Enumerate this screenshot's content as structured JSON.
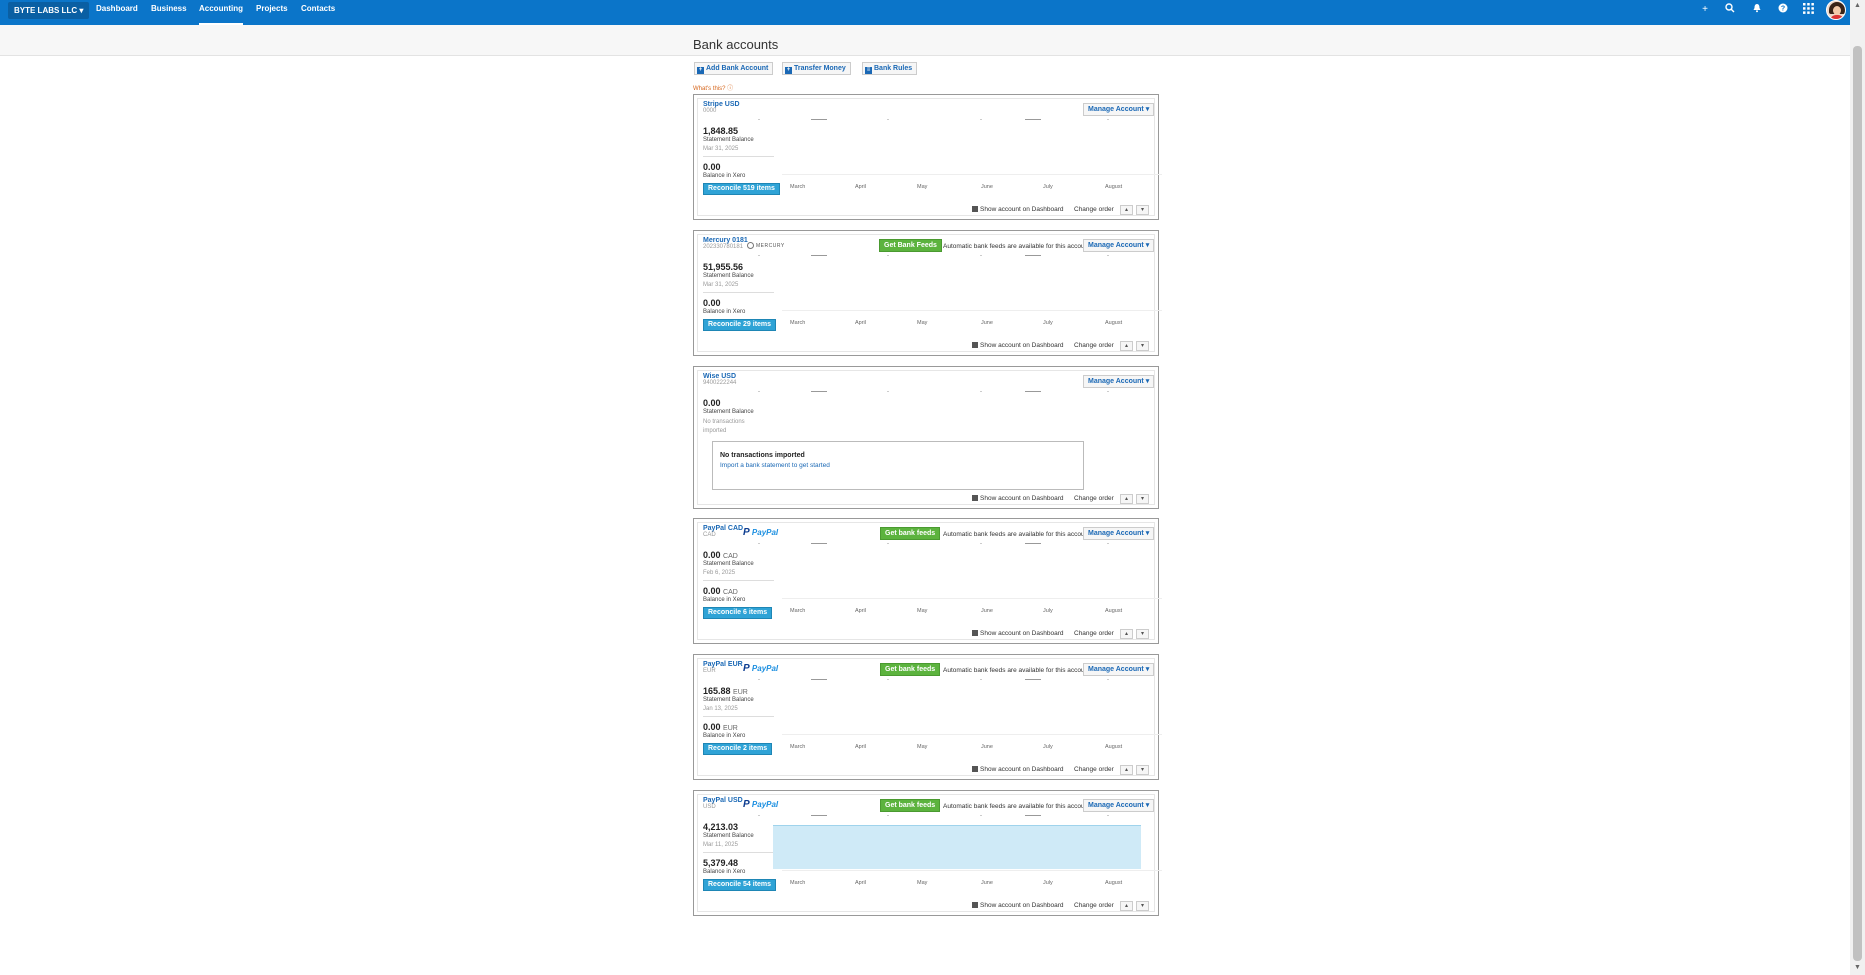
{
  "topbar": {
    "org": "BYTE LABS LLC",
    "nav": [
      "Dashboard",
      "Business",
      "Accounting",
      "Projects",
      "Contacts"
    ],
    "active": "Accounting",
    "icons": [
      "plus-icon",
      "search-icon",
      "bell-icon",
      "help-icon",
      "apps-grid-icon",
      "avatar"
    ]
  },
  "page": {
    "title": "Bank accounts",
    "toolbar": [
      "Add Bank Account",
      "Transfer Money",
      "Bank Rules"
    ],
    "whats_this": "What's this?"
  },
  "common": {
    "manage": "Manage Account",
    "feeds_note": "Automatic bank feeds are available for this account",
    "show_dashboard": "Show account on Dashboard",
    "change_order": "Change order",
    "statement_balance": "Statement Balance",
    "balance_in_xero": "Balance in Xero",
    "months": [
      "March",
      "April",
      "May",
      "June",
      "July",
      "August"
    ]
  },
  "accounts": [
    {
      "name": "Stripe USD",
      "number": "0000",
      "logo": "",
      "feeds_button": "",
      "statement_balance": "1,848.85",
      "statement_currency": "",
      "statement_date": "Mar 31, 2025",
      "xero_balance": "0.00",
      "xero_currency": "",
      "reconcile": "Reconcile 519 items"
    },
    {
      "name": "Mercury 0181",
      "number": "202330780181",
      "logo": "MERCURY",
      "feeds_button": "Get Bank Feeds",
      "statement_balance": "51,955.56",
      "statement_currency": "",
      "statement_date": "Mar 31, 2025",
      "xero_balance": "0.00",
      "xero_currency": "",
      "reconcile": "Reconcile 29 items"
    },
    {
      "name": "Wise USD",
      "number": "9400222244",
      "logo": "",
      "feeds_button": "",
      "statement_balance": "0.00",
      "statement_currency": "",
      "statement_date": "No transactions imported",
      "no_import_title": "No transactions imported",
      "no_import_link": "Import a bank statement to get started"
    },
    {
      "name": "PayPal CAD",
      "number": "CAD",
      "logo": "PayPal",
      "feeds_button": "Get bank feeds",
      "statement_balance": "0.00",
      "statement_currency": "CAD",
      "statement_date": "Feb 6, 2025",
      "xero_balance": "0.00",
      "xero_currency": "CAD",
      "reconcile": "Reconcile 6 items"
    },
    {
      "name": "PayPal EUR",
      "number": "EUR",
      "logo": "PayPal",
      "feeds_button": "Get bank feeds",
      "statement_balance": "165.88",
      "statement_currency": "EUR",
      "statement_date": "Jan 13, 2025",
      "xero_balance": "0.00",
      "xero_currency": "EUR",
      "reconcile": "Reconcile 2 items"
    },
    {
      "name": "PayPal USD",
      "number": "USD",
      "logo": "PayPal",
      "feeds_button": "Get bank feeds",
      "statement_balance": "4,213.03",
      "statement_currency": "",
      "statement_date": "Mar 11, 2025",
      "xero_balance": "5,379.48",
      "xero_currency": "",
      "reconcile": "Reconcile 54 items"
    }
  ],
  "colors": {
    "brand": "#0b75c9",
    "reconcile": "#2fa3d6",
    "feeds": "#5cb33e",
    "link": "#1a68b5"
  }
}
